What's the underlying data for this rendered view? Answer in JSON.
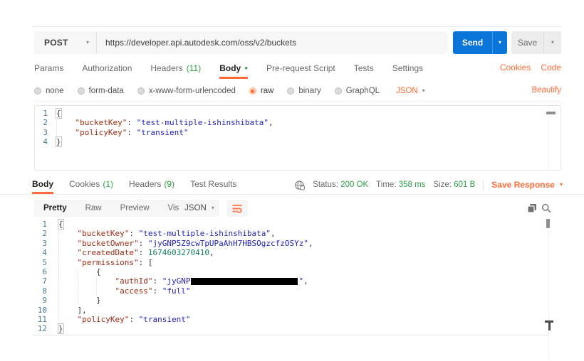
{
  "colors": {
    "accent_orange": "#FF6C37",
    "send_blue": "#0B74D8",
    "success_green": "#2BA143",
    "code_key": "#9D2C13",
    "code_string": "#1E1EBE",
    "code_number": "#14825A"
  },
  "icons": {
    "caret_down": "▾",
    "unsaved_dot": "●"
  },
  "request_bar": {
    "method": "POST",
    "url": "https://developer.api.autodesk.com/oss/v2/buckets",
    "send": "Send",
    "save": "Save"
  },
  "request_tabs": {
    "items": [
      {
        "label": "Params"
      },
      {
        "label": "Authorization"
      },
      {
        "label": "Headers",
        "count": "(11)"
      },
      {
        "label": "Body",
        "active": true,
        "dot": true
      },
      {
        "label": "Pre-request Script"
      },
      {
        "label": "Tests"
      },
      {
        "label": "Settings"
      }
    ],
    "cookies": "Cookies",
    "code": "Code"
  },
  "body_type": {
    "options": [
      {
        "label": "none"
      },
      {
        "label": "form-data"
      },
      {
        "label": "x-www-form-urlencoded"
      },
      {
        "label": "raw",
        "selected": true
      },
      {
        "label": "binary"
      },
      {
        "label": "GraphQL"
      }
    ],
    "format": "JSON",
    "beautify": "Beautify"
  },
  "request_body": {
    "lines": [
      "{",
      "    \"bucketKey\": \"test-multiple-ishinshibata\",",
      "    \"policyKey\": \"transient\"",
      "}"
    ]
  },
  "response_meta": {
    "tabs": [
      {
        "label": "Body",
        "active": true
      },
      {
        "label": "Cookies",
        "count": "(1)"
      },
      {
        "label": "Headers",
        "count": "(9)"
      },
      {
        "label": "Test Results"
      }
    ],
    "status_label": "Status:",
    "status_value": "200 OK",
    "time_label": "Time:",
    "time_value": "358 ms",
    "size_label": "Size:",
    "size_value": "601 B",
    "save_response": "Save Response"
  },
  "response_toolbar": {
    "views": [
      {
        "label": "Pretty",
        "active": true
      },
      {
        "label": "Raw"
      },
      {
        "label": "Preview"
      },
      {
        "label": "Visualize"
      }
    ],
    "format": "JSON"
  },
  "response_body": {
    "lines": [
      "{",
      "    \"bucketKey\": \"test-multiple-ishinshibata\",",
      "    \"bucketOwner\": \"jyGNP5Z9cwTpUPaAhH7HBSOgzcfzOSYz\",",
      "    \"createdDate\": 1674603270410,",
      "    \"permissions\": [",
      "        {",
      "            \"authId\": \"jyGNP{{REDACTED}}\",",
      "            \"access\": \"full\"",
      "        }",
      "    ],",
      "    \"policyKey\": \"transient\"",
      "}"
    ]
  }
}
